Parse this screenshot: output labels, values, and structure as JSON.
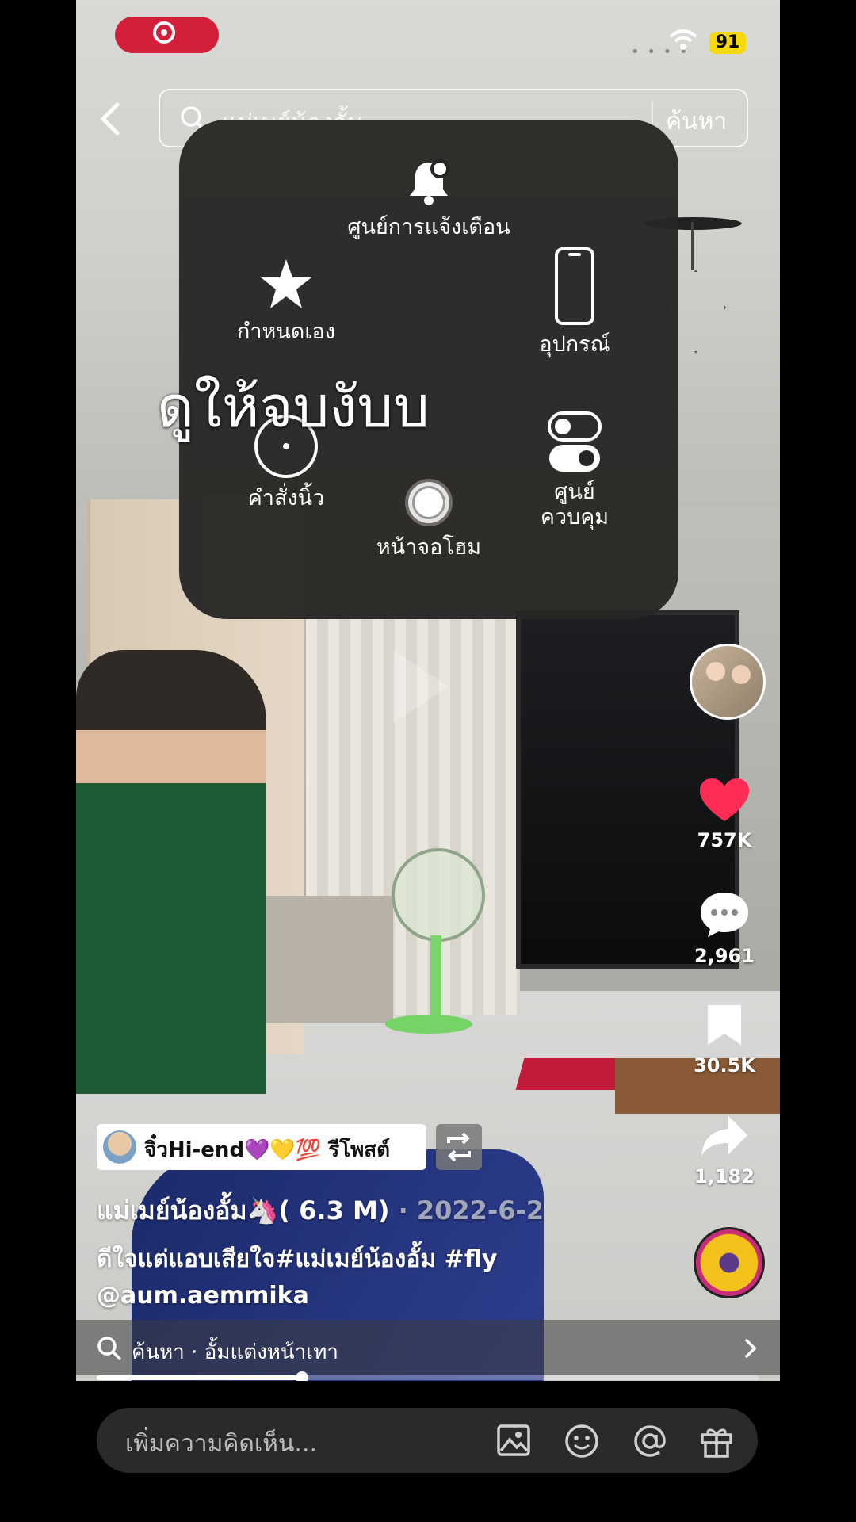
{
  "status_bar": {
    "battery": "91",
    "signal_dots": "• • • •"
  },
  "search": {
    "placeholder": "แม่เมย์น้องอั้ม",
    "button": "ค้นหา"
  },
  "assistive_menu": {
    "items": [
      {
        "label": "ศูนย์การแจ้งเตือน",
        "icon": "bell-icon"
      },
      {
        "label": "กำหนดเอง",
        "icon": "star-icon"
      },
      {
        "label": "อุปกรณ์",
        "icon": "phone-device-icon"
      },
      {
        "label": "คำสั่งนิ้ว",
        "icon": "gesture-circle-icon"
      },
      {
        "label": "ศูนย์\nควบคุม",
        "icon": "toggle-switches-icon"
      },
      {
        "label": "หน้าจอโฮม",
        "icon": "home-button-icon"
      }
    ]
  },
  "overlay_caption": "ดูให้จบงับบ",
  "right_rail": {
    "likes": "757K",
    "comments": "2,961",
    "saves": "30.5K",
    "shares": "1,182"
  },
  "repost": {
    "text": "จิ๋วHi-end💜💛💯 รีโพสต์"
  },
  "author": {
    "name": "แม่เมย์น้องอั้ม🦄( 6.3 M)",
    "date": " · 2022-6-2"
  },
  "description": {
    "line1": "ดีใจแต่แอบเสียใจ#แม่เมย์น้องอั้ม #fly",
    "line2": "@aum.aemmika"
  },
  "search_suggestion": "ค้นหา · อั้มแต่งหน้าเทา",
  "progress": {
    "fraction": 0.31
  },
  "comment": {
    "placeholder": "เพิ่มความคิดเห็น..."
  },
  "colors": {
    "like": "#ff2d55",
    "record": "#d41f3c",
    "battery": "#f5d90a"
  }
}
